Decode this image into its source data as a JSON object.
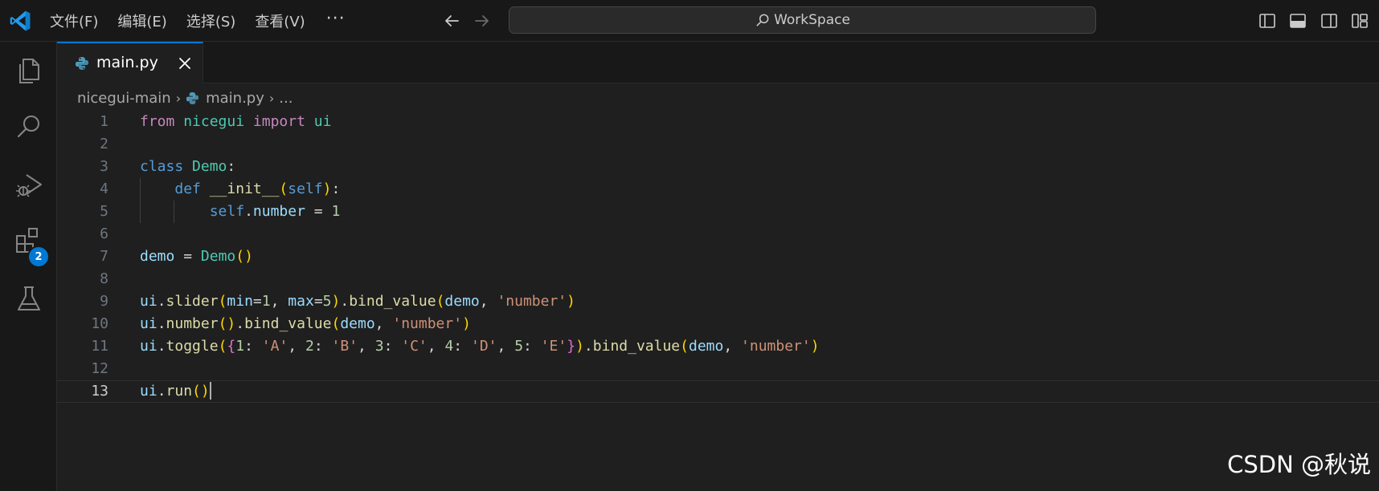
{
  "titlebar": {
    "menu": [
      "文件(F)",
      "编辑(E)",
      "选择(S)",
      "查看(V)"
    ],
    "more": "···",
    "search_text": "WorkSpace"
  },
  "activity_bar": {
    "icons": [
      "explorer-icon",
      "search-icon",
      "run-debug-icon",
      "extensions-icon",
      "testing-icon"
    ],
    "extensions_badge": "2"
  },
  "tab": {
    "label": "main.py",
    "language_icon": "python-icon"
  },
  "breadcrumb": {
    "folder": "nicegui-main",
    "file": "main.py",
    "more": "..."
  },
  "editor": {
    "active_line": 13,
    "lines": [
      {
        "n": "1",
        "text": "from nicegui import ui"
      },
      {
        "n": "2",
        "text": ""
      },
      {
        "n": "3",
        "text": "class Demo:"
      },
      {
        "n": "4",
        "text": "    def __init__(self):"
      },
      {
        "n": "5",
        "text": "        self.number = 1"
      },
      {
        "n": "6",
        "text": ""
      },
      {
        "n": "7",
        "text": "demo = Demo()"
      },
      {
        "n": "8",
        "text": ""
      },
      {
        "n": "9",
        "text": "ui.slider(min=1, max=5).bind_value(demo, 'number')"
      },
      {
        "n": "10",
        "text": "ui.number().bind_value(demo, 'number')"
      },
      {
        "n": "11",
        "text": "ui.toggle({1: 'A', 2: 'B', 3: 'C', 4: 'D', 5: 'E'}).bind_value(demo, 'number')"
      },
      {
        "n": "12",
        "text": ""
      },
      {
        "n": "13",
        "text": "ui.run()"
      }
    ]
  },
  "watermark": "CSDN @秋说",
  "colors": {
    "accent": "#0078d4",
    "keyword_control": "#c586c0",
    "keyword": "#569cd6",
    "class_name": "#4ec9b0",
    "function": "#dcdcaa",
    "variable": "#9cdcfe",
    "number": "#b5cea8",
    "string": "#ce9178",
    "bracket_1": "#ffd700",
    "bracket_2": "#da70d6",
    "bracket_3": "#179fff"
  }
}
